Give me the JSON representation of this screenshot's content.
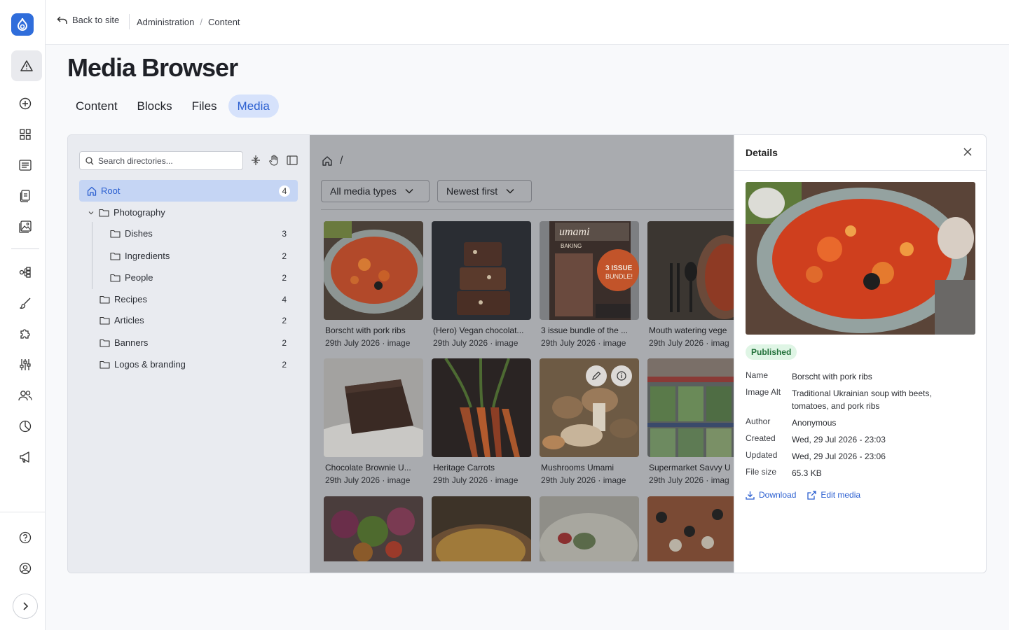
{
  "topbar": {
    "back_label": "Back to site",
    "breadcrumb": [
      "Administration",
      "Content"
    ],
    "separator": "/"
  },
  "page": {
    "title": "Media Browser"
  },
  "tabs": [
    {
      "label": "Content",
      "active": false
    },
    {
      "label": "Blocks",
      "active": false
    },
    {
      "label": "Files",
      "active": false
    },
    {
      "label": "Media",
      "active": true
    }
  ],
  "tree": {
    "search_placeholder": "Search directories...",
    "items": [
      {
        "label": "Root",
        "count": "4"
      },
      {
        "label": "Photography",
        "count": ""
      },
      {
        "label": "Dishes",
        "count": "3"
      },
      {
        "label": "Ingredients",
        "count": "2"
      },
      {
        "label": "People",
        "count": "2"
      },
      {
        "label": "Recipes",
        "count": "4"
      },
      {
        "label": "Articles",
        "count": "2"
      },
      {
        "label": "Banners",
        "count": "2"
      },
      {
        "label": "Logos & branding",
        "count": "2"
      }
    ]
  },
  "browser": {
    "path_sep": "/",
    "filter_type": "All media types",
    "sort": "Newest first",
    "items": [
      {
        "name": "Borscht with pork ribs",
        "meta": "29th July 2026 · image"
      },
      {
        "name": "(Hero) Vegan chocolat...",
        "meta": "29th July 2026 · image"
      },
      {
        "name": "3 issue bundle of the ...",
        "meta": "29th July 2026 · image"
      },
      {
        "name": "Mouth watering vege",
        "meta": "29th July 2026 · imag"
      },
      {
        "name": "Chocolate Brownie U...",
        "meta": "29th July 2026 · image"
      },
      {
        "name": "Heritage Carrots",
        "meta": "29th July 2026 · image"
      },
      {
        "name": "Mushrooms Umami",
        "meta": "29th July 2026 · image"
      },
      {
        "name": "Supermarket Savvy U",
        "meta": "29th July 2026 · imag"
      }
    ],
    "magazine_text": {
      "brand": "umami",
      "sub": "BAKING",
      "bundle": "3 ISSUE BUNDLE!"
    }
  },
  "details": {
    "title": "Details",
    "status": "Published",
    "fields": [
      {
        "key": "Name",
        "value": "Borscht with pork ribs"
      },
      {
        "key": "Image Alt",
        "value": "Traditional Ukrainian soup with beets, tomatoes, and pork ribs"
      },
      {
        "key": "Author",
        "value": "Anonymous"
      },
      {
        "key": "Created",
        "value": "Wed, 29 Jul 2026 - 23:03"
      },
      {
        "key": "Updated",
        "value": "Wed, 29 Jul 2026 - 23:06"
      },
      {
        "key": "File size",
        "value": "65.3 KB"
      }
    ],
    "download_label": "Download",
    "edit_label": "Edit media"
  },
  "colors": {
    "accent": "#2b5fd0",
    "logo": "#2f6ddb",
    "published_bg": "#dff5e5"
  }
}
